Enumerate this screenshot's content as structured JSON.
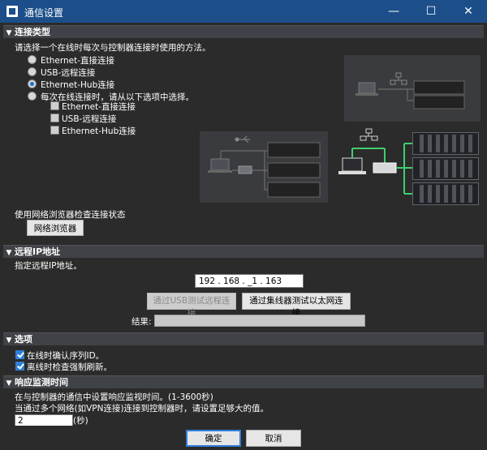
{
  "window": {
    "title": "通信设置",
    "minimize": "—",
    "maximize": "☐",
    "close": "✕"
  },
  "connection_type": {
    "header": "连接类型",
    "instruction": "请选择一个在线时每次与控制器连接时使用的方法。",
    "options": [
      {
        "label": "Ethernet-直接连接",
        "selected": false
      },
      {
        "label": "USB-远程连接",
        "selected": false
      },
      {
        "label": "Ethernet-Hub连接",
        "selected": true
      },
      {
        "label": "每次在线连接时，请从以下选项中选择。",
        "selected": false
      }
    ],
    "sub_options": [
      {
        "label": "Ethernet-直接连接",
        "checked": false
      },
      {
        "label": "USB-远程连接",
        "checked": false
      },
      {
        "label": "Ethernet-Hub连接",
        "checked": false
      }
    ],
    "browser_hint": "使用网络浏览器检查连接状态",
    "browser_button": "网络浏览器"
  },
  "remote_ip": {
    "header": "远程IP地址",
    "instruction": "指定远程IP地址。",
    "ip_value": "192 . 168 . _1 . 163",
    "test_usb_button": "通过USB测试远程连接",
    "test_hub_button": "通过集线器测试以太网连接",
    "result_label": "结果:",
    "result_value": ""
  },
  "options": {
    "header": "选项",
    "items": [
      {
        "label": "在线时确认序列ID。",
        "checked": true
      },
      {
        "label": "离线时检查强制刷新。",
        "checked": true
      }
    ]
  },
  "response": {
    "header": "响应监测时间",
    "line1": "在与控制器的通信中设置响应监视时间。(1-3600秒)",
    "line2": "当通过多个网络(如VPN连接)连接到控制器时，请设置足够大的值。",
    "value": "2",
    "unit": "(秒)"
  },
  "footer": {
    "ok": "确定",
    "cancel": "取消"
  },
  "colors": {
    "accent": "#2d7fd9",
    "link": "#3ecf6f",
    "titlebar": "#1c4f8a"
  }
}
